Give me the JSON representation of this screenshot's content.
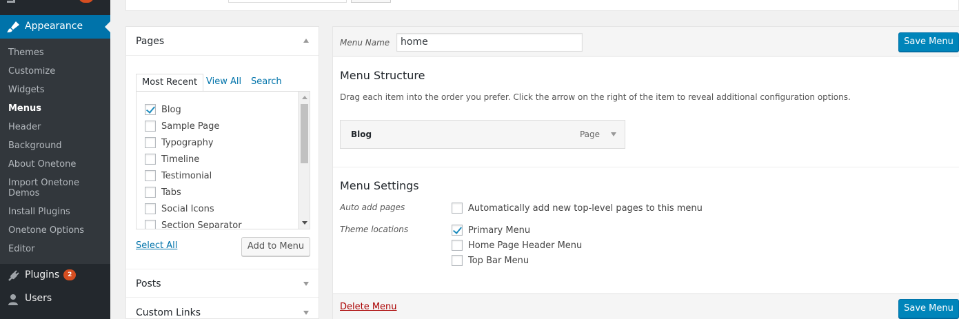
{
  "sidebar": {
    "appearance_label": "Appearance",
    "submenu": [
      "Themes",
      "Customize",
      "Widgets",
      "Menus",
      "Header",
      "Background",
      "About Onetone",
      "Import Onetone Demos",
      "Install Plugins",
      "Onetone Options",
      "Editor"
    ],
    "current": "Menus",
    "plugins_label": "Plugins",
    "plugins_badge": "2",
    "users_label": "Users"
  },
  "pages_box": {
    "title": "Pages",
    "tabs": [
      "Most Recent",
      "View All",
      "Search"
    ],
    "items": [
      {
        "label": "Blog",
        "checked": true
      },
      {
        "label": "Sample Page",
        "checked": false
      },
      {
        "label": "Typography",
        "checked": false
      },
      {
        "label": "Timeline",
        "checked": false
      },
      {
        "label": "Testimonial",
        "checked": false
      },
      {
        "label": "Tabs",
        "checked": false
      },
      {
        "label": "Social Icons",
        "checked": false
      },
      {
        "label": "Section Separator",
        "checked": false
      }
    ],
    "select_all": "Select All",
    "add_button": "Add to Menu"
  },
  "posts_box": {
    "title": "Posts"
  },
  "custom_links_box": {
    "title": "Custom Links"
  },
  "editor": {
    "menu_name_label": "Menu Name",
    "menu_name_value": "home",
    "save_label": "Save Menu",
    "structure_title": "Menu Structure",
    "structure_desc": "Drag each item into the order you prefer. Click the arrow on the right of the item to reveal additional configuration options.",
    "menu_item": {
      "title": "Blog",
      "type": "Page"
    },
    "settings_title": "Menu Settings",
    "auto_add_label": "Auto add pages",
    "auto_add_option": "Automatically add new top-level pages to this menu",
    "theme_locations_label": "Theme locations",
    "locations": [
      {
        "label": "Primary Menu",
        "checked": true
      },
      {
        "label": "Home Page Header Menu",
        "checked": false
      },
      {
        "label": "Top Bar Menu",
        "checked": false
      }
    ],
    "delete_label": "Delete Menu"
  }
}
